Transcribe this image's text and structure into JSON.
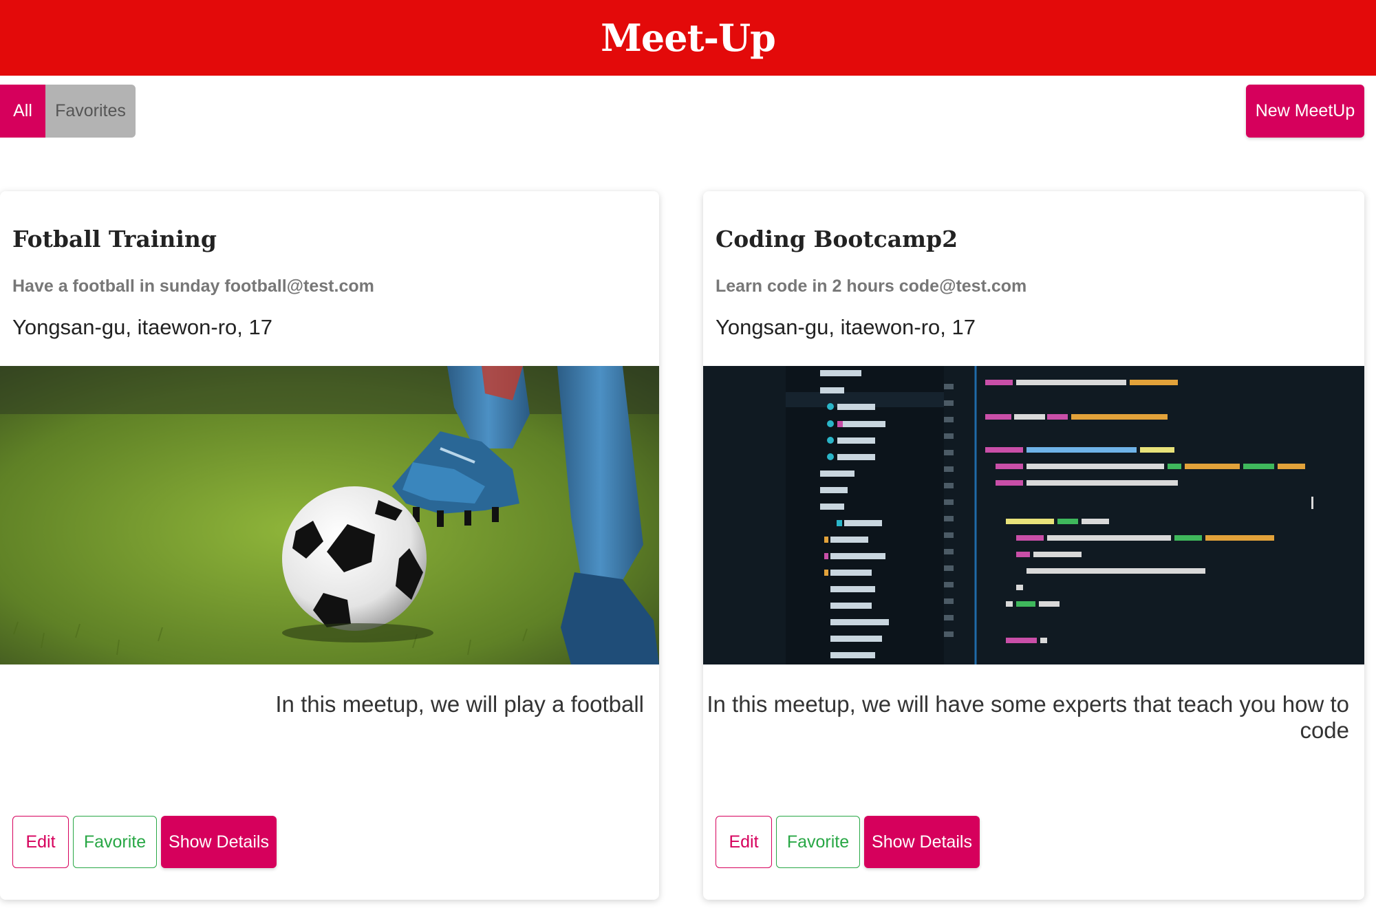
{
  "header": {
    "title": "Meet-Up"
  },
  "filters": {
    "all_label": "All",
    "favorites_label": "Favorites"
  },
  "actions": {
    "new_meetup_label": "New MeetUp"
  },
  "meetups": [
    {
      "title": "Fotball Training",
      "subtitle": "Have a football in sunday football@test.com",
      "address": "Yongsan-gu, itaewon-ro, 17",
      "description": "In this meetup, we will play a football",
      "edit_label": "Edit",
      "favorite_label": "Favorite",
      "details_label": "Show Details"
    },
    {
      "title": "Coding Bootcamp2",
      "subtitle": "Learn code in 2 hours code@test.com",
      "address": "Yongsan-gu, itaewon-ro, 17",
      "description": "In this meetup, we will have some experts that teach you how to code",
      "edit_label": "Edit",
      "favorite_label": "Favorite",
      "details_label": "Show Details"
    }
  ],
  "colors": {
    "header_bg": "#e30a0a",
    "accent": "#d6005c",
    "favorite_green": "#28a745",
    "favorites_filter_bg": "#b3b3b3"
  }
}
